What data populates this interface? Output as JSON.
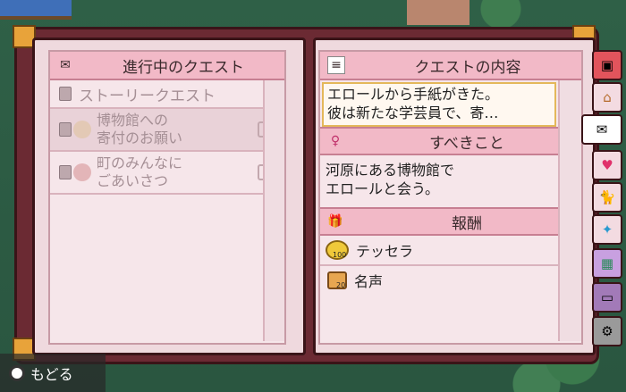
{
  "left_panel": {
    "title": "進行中のクエスト",
    "category": "ストーリークエスト",
    "quests": [
      {
        "line1": "博物館への",
        "line2": "寄付のお願い"
      },
      {
        "line1": "町のみんなに",
        "line2": "ごあいさつ"
      }
    ]
  },
  "right_panel": {
    "title": "クエストの内容",
    "description_line1": "エロールから手紙がきた。",
    "description_line2": "彼は新たな学芸員で、寄…",
    "todo_title": "すべきこと",
    "todo_line1": "河原にある博物館で",
    "todo_line2": "エロールと会う。",
    "reward_title": "報酬",
    "rewards": [
      {
        "name": "テッセラ",
        "amount": "100",
        "icon": "tessera-coin-icon"
      },
      {
        "name": "名声",
        "amount": "20",
        "icon": "fame-fist-icon"
      }
    ]
  },
  "footer": {
    "back_label": "もどる"
  },
  "tabs": [
    "backpack-tab",
    "house-tab",
    "quest-tab",
    "heart-tab",
    "animal-tab",
    "sparkle-tab",
    "map-tab",
    "message-tab",
    "settings-tab"
  ]
}
